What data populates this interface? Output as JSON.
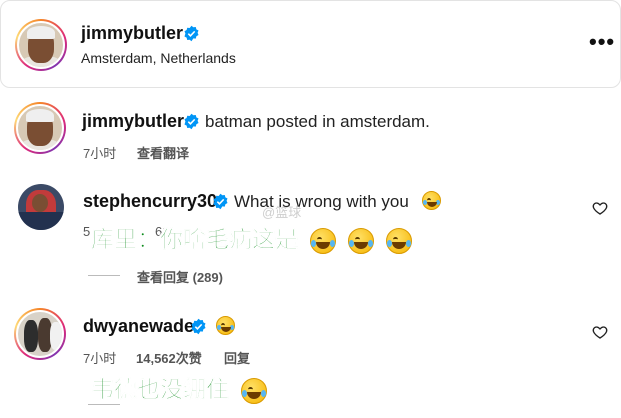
{
  "header": {
    "username": "jimmybutler",
    "location": "Amsterdam, Netherlands",
    "more_label": "•••"
  },
  "comments": [
    {
      "username": "jimmybutler",
      "text": "batman posted in amsterdam.",
      "time": "7小时",
      "translate_label": "查看翻译"
    },
    {
      "username": "stephencurry30",
      "text": "What is wrong with you",
      "time": "5",
      "likes_fragment": "61",
      "view_replies_label": "查看回复 (289)",
      "overlay_caption": "库里：你啥毛病这是"
    },
    {
      "username": "dwyanewade",
      "text": "",
      "time": "7小时",
      "likes": "14,562次赞",
      "reply_label": "回复",
      "overlay_caption": "韦德也没绷住"
    }
  ],
  "watermark_text": "@篮球",
  "colors": {
    "verified_blue": "#0095f6",
    "overlay_green": "#0a8a1a",
    "story_ring": "#dd2a7b"
  },
  "icons": [
    "verified-badge-icon",
    "heart-icon",
    "more-options-icon",
    "face-with-tears-of-joy-emoji"
  ]
}
